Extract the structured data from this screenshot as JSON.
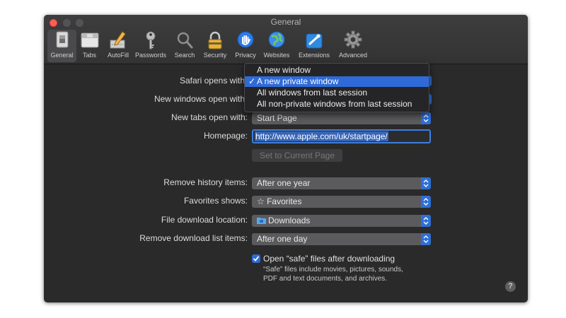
{
  "window": {
    "title": "General"
  },
  "toolbar": {
    "tabs": [
      {
        "label": "General",
        "icon": "switch-icon",
        "selected": true
      },
      {
        "label": "Tabs",
        "icon": "tabs-icon"
      },
      {
        "label": "AutoFill",
        "icon": "pencil-icon"
      },
      {
        "label": "Passwords",
        "icon": "key-icon"
      },
      {
        "label": "Search",
        "icon": "magnifier-icon"
      },
      {
        "label": "Security",
        "icon": "padlock-icon"
      },
      {
        "label": "Privacy",
        "icon": "hand-icon"
      },
      {
        "label": "Websites",
        "icon": "globe-icon"
      },
      {
        "label": "Extensions",
        "icon": "puzzle-icon"
      },
      {
        "label": "Advanced",
        "icon": "gear-icon"
      }
    ]
  },
  "general": {
    "safari_opens_with_label": "Safari opens with",
    "new_windows_open_with_label": "New windows open with",
    "new_tabs_open_with_label": "New tabs open with:",
    "new_tabs_open_with_value": "Start Page",
    "homepage_label": "Homepage:",
    "homepage_value": "http://www.apple.com/uk/startpage/",
    "set_current_page_button": "Set to Current Page",
    "remove_history_label": "Remove history items:",
    "remove_history_value": "After one year",
    "favorites_shows_label": "Favorites shows:",
    "favorites_shows_value": "Favorites",
    "file_download_label": "File download location:",
    "file_download_value": "Downloads",
    "remove_download_label": "Remove download list items:",
    "remove_download_value": "After one day",
    "open_safe_files_label": "Open “safe” files after downloading",
    "open_safe_files_checked": true,
    "safe_files_help": "“Safe” files include movies, pictures, sounds, PDF and text documents, and archives.",
    "help_button": "?"
  },
  "dropdown_menu": {
    "items": [
      {
        "label": "A new window",
        "highlighted": false
      },
      {
        "label": "A new private window",
        "highlighted": true,
        "checked": true
      },
      {
        "label": "All windows from last session",
        "highlighted": false
      },
      {
        "label": "All non-private windows from last session",
        "highlighted": false
      }
    ],
    "check_mark": "✓"
  },
  "colors": {
    "accent": "#2f6bd8",
    "window_bg": "#2a2a2b",
    "select_bg": "#5b5b5e",
    "close_button": "#fc5f57"
  }
}
